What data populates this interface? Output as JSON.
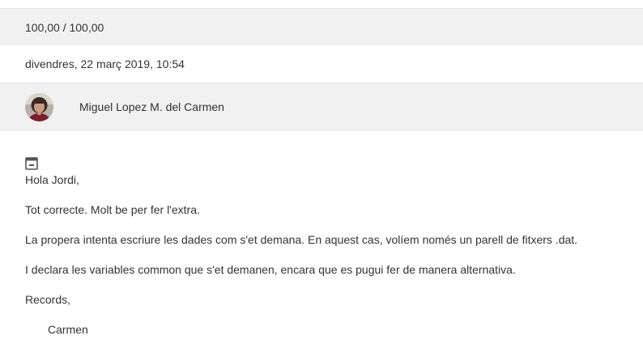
{
  "grade": {
    "value": "100,00 / 100,00"
  },
  "submission": {
    "date": "divendres, 22 març 2019, 10:54"
  },
  "author": {
    "name": "Miguel Lopez M. del Carmen",
    "avatar_icon": "user-avatar-photo"
  },
  "message": {
    "collapse_icon": "collapse-window-icon",
    "paragraphs": [
      "Hola Jordi,",
      "Tot correcte. Molt be per fer l'extra.",
      "La propera intenta escriure les dades com s'et demana. En aquest cas, volíem només un parell de fitxers .dat.",
      "I declara les variables common que s'et demanen, encara que es pugui fer de manera alternativa.",
      "Records,",
      "Carmen"
    ]
  },
  "colors": {
    "row_background": "#f1f1f1",
    "text": "#333333",
    "icon": "#555555"
  }
}
